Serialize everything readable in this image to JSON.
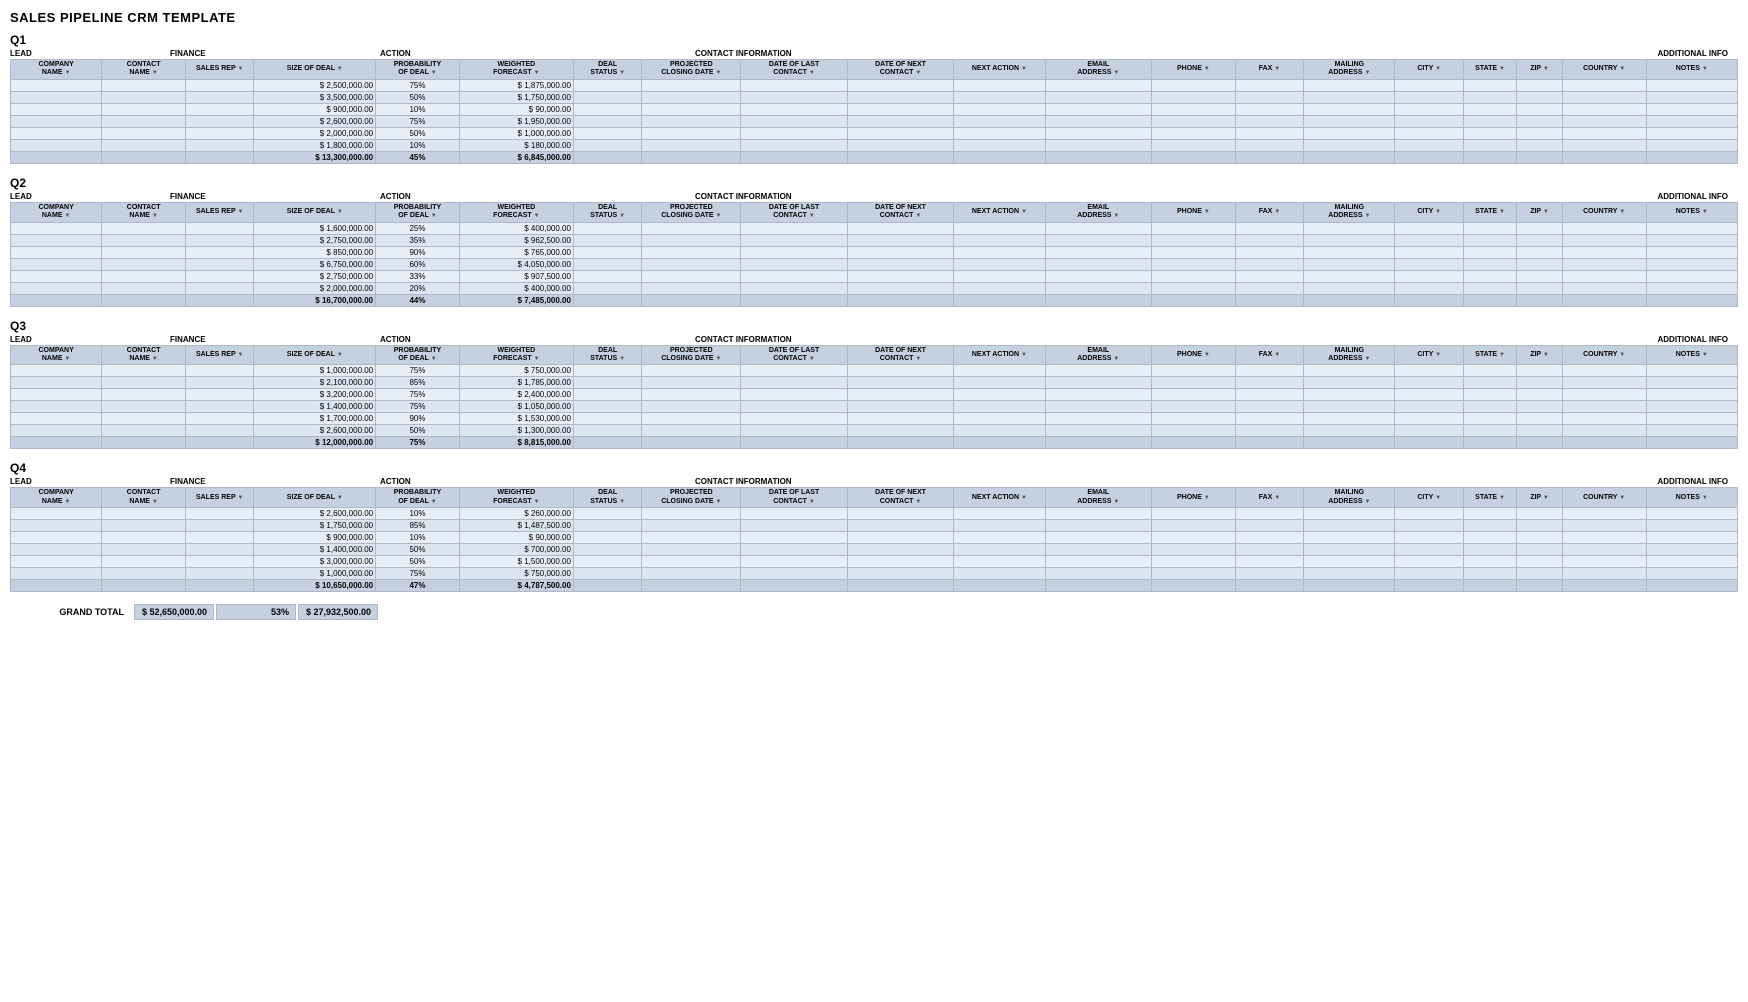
{
  "title": "SALES PIPELINE CRM TEMPLATE",
  "headers": {
    "company_name": "COMPANY NAME",
    "contact_name": "CONTACT NAME",
    "sales_rep": "SALES REP",
    "size_of_deal": "SIZE OF DEAL",
    "probability_of_deal": "PROBABILITY OF DEAL",
    "weighted_forecast": "WEIGHTED FORECAST",
    "deal_status": "DEAL STATUS",
    "projected_closing_date": "PROJECTED CLOSING DATE",
    "date_of_last_contact": "DATE OF LAST CONTACT",
    "date_of_next_contact": "DATE OF NEXT CONTACT",
    "next_action": "NEXT ACTION",
    "email_address": "EMAIL ADDRESS",
    "phone": "PHONE",
    "fax": "FAX",
    "mailing_address": "MAILING ADDRESS",
    "city": "CITY",
    "state": "STATE",
    "zip": "ZIP",
    "country": "COUNTRY",
    "notes": "NOTES"
  },
  "section_labels": {
    "lead": "LEAD",
    "finance": "FINANCE",
    "action": "ACTION",
    "contact_information": "CONTACT INFORMATION",
    "additional_info": "ADDITIONAL INFO"
  },
  "quarters": [
    {
      "name": "Q1",
      "rows": [
        {
          "deal": "2,500,000.00",
          "prob": "75%",
          "weighted": "1,875,000.00"
        },
        {
          "deal": "3,500,000.00",
          "prob": "50%",
          "weighted": "1,750,000.00"
        },
        {
          "deal": "900,000.00",
          "prob": "10%",
          "weighted": "90,000.00"
        },
        {
          "deal": "2,600,000.00",
          "prob": "75%",
          "weighted": "1,950,000.00"
        },
        {
          "deal": "2,000,000.00",
          "prob": "50%",
          "weighted": "1,000,000.00"
        },
        {
          "deal": "1,800,000.00",
          "prob": "10%",
          "weighted": "180,000.00"
        }
      ],
      "total_deal": "13,300,000.00",
      "total_prob": "45%",
      "total_weighted": "6,845,000.00"
    },
    {
      "name": "Q2",
      "rows": [
        {
          "deal": "1,600,000.00",
          "prob": "25%",
          "weighted": "400,000.00"
        },
        {
          "deal": "2,750,000.00",
          "prob": "35%",
          "weighted": "962,500.00"
        },
        {
          "deal": "850,000.00",
          "prob": "90%",
          "weighted": "765,000.00"
        },
        {
          "deal": "6,750,000.00",
          "prob": "60%",
          "weighted": "4,050,000.00"
        },
        {
          "deal": "2,750,000.00",
          "prob": "33%",
          "weighted": "907,500.00"
        },
        {
          "deal": "2,000,000.00",
          "prob": "20%",
          "weighted": "400,000.00"
        }
      ],
      "total_deal": "16,700,000.00",
      "total_prob": "44%",
      "total_weighted": "7,485,000.00"
    },
    {
      "name": "Q3",
      "rows": [
        {
          "deal": "1,000,000.00",
          "prob": "75%",
          "weighted": "750,000.00"
        },
        {
          "deal": "2,100,000.00",
          "prob": "85%",
          "weighted": "1,785,000.00"
        },
        {
          "deal": "3,200,000.00",
          "prob": "75%",
          "weighted": "2,400,000.00"
        },
        {
          "deal": "1,400,000.00",
          "prob": "75%",
          "weighted": "1,050,000.00"
        },
        {
          "deal": "1,700,000.00",
          "prob": "90%",
          "weighted": "1,530,000.00"
        },
        {
          "deal": "2,600,000.00",
          "prob": "50%",
          "weighted": "1,300,000.00"
        }
      ],
      "total_deal": "12,000,000.00",
      "total_prob": "75%",
      "total_weighted": "8,815,000.00"
    },
    {
      "name": "Q4",
      "rows": [
        {
          "deal": "2,600,000.00",
          "prob": "10%",
          "weighted": "260,000.00"
        },
        {
          "deal": "1,750,000.00",
          "prob": "85%",
          "weighted": "1,487,500.00"
        },
        {
          "deal": "900,000.00",
          "prob": "10%",
          "weighted": "90,000.00"
        },
        {
          "deal": "1,400,000.00",
          "prob": "50%",
          "weighted": "700,000.00"
        },
        {
          "deal": "3,000,000.00",
          "prob": "50%",
          "weighted": "1,500,000.00"
        },
        {
          "deal": "1,000,000.00",
          "prob": "75%",
          "weighted": "750,000.00"
        }
      ],
      "total_deal": "10,650,000.00",
      "total_prob": "47%",
      "total_weighted": "4,787,500.00"
    }
  ],
  "grand_total": {
    "label": "GRAND TOTAL",
    "deal": "$ 52,650,000.00",
    "prob": "53%",
    "weighted": "$ 27,932,500.00"
  }
}
